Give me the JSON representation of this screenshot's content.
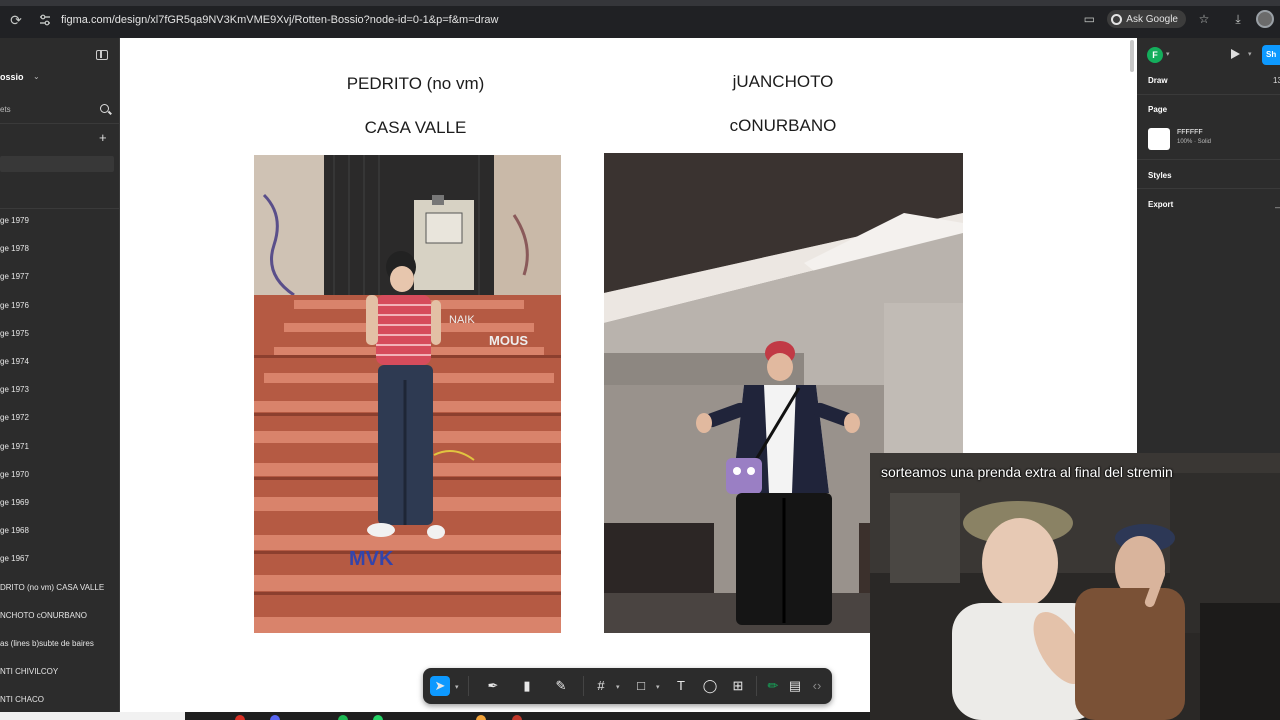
{
  "browser": {
    "url": "figma.com/design/xl7fGR5qa9NV3KmVME9Xvj/Rotten-Bossio?node-id=0-1&p=f&m=draw",
    "ask_google_label": "Ask Google"
  },
  "left_panel": {
    "project_name": "ossio",
    "assets_label": "ets",
    "layers": [
      "ge 1979",
      "ge 1978",
      "ge 1977",
      "ge 1976",
      "ge 1975",
      "ge 1974",
      "ge 1973",
      "ge 1972",
      "ge 1971",
      "ge 1970",
      "ge 1969",
      "ge 1968",
      "ge 1967",
      "DRITO (no vm) CASA VALLE",
      "NCHOTO cONURBANO",
      "as (lines b)subte de baires",
      "NTI CHIVILCOY",
      "NTI CHACO"
    ]
  },
  "canvas": {
    "left_title_1": "PEDRITO (no vm)",
    "left_title_2": "CASA VALLE",
    "right_title_1": "jUANCHOTO",
    "right_title_2": "cONURBANO"
  },
  "right_panel": {
    "avatar_letter": "F",
    "share_label": "Sh",
    "tab_draw": "Draw",
    "zoom": "13",
    "page_heading": "Page",
    "page_fill_hex": "FFFFFF",
    "page_fill_sub": "100% · Solid",
    "styles_heading": "Styles",
    "export_heading": "Export"
  },
  "overlay": {
    "caption": "sorteamos una prenda extra al final del stremin"
  },
  "colors": {
    "accent": "#0d99ff",
    "panel_bg": "#2c2c2c",
    "canvas_bg": "#ffffff",
    "browser_bg": "#202124"
  }
}
